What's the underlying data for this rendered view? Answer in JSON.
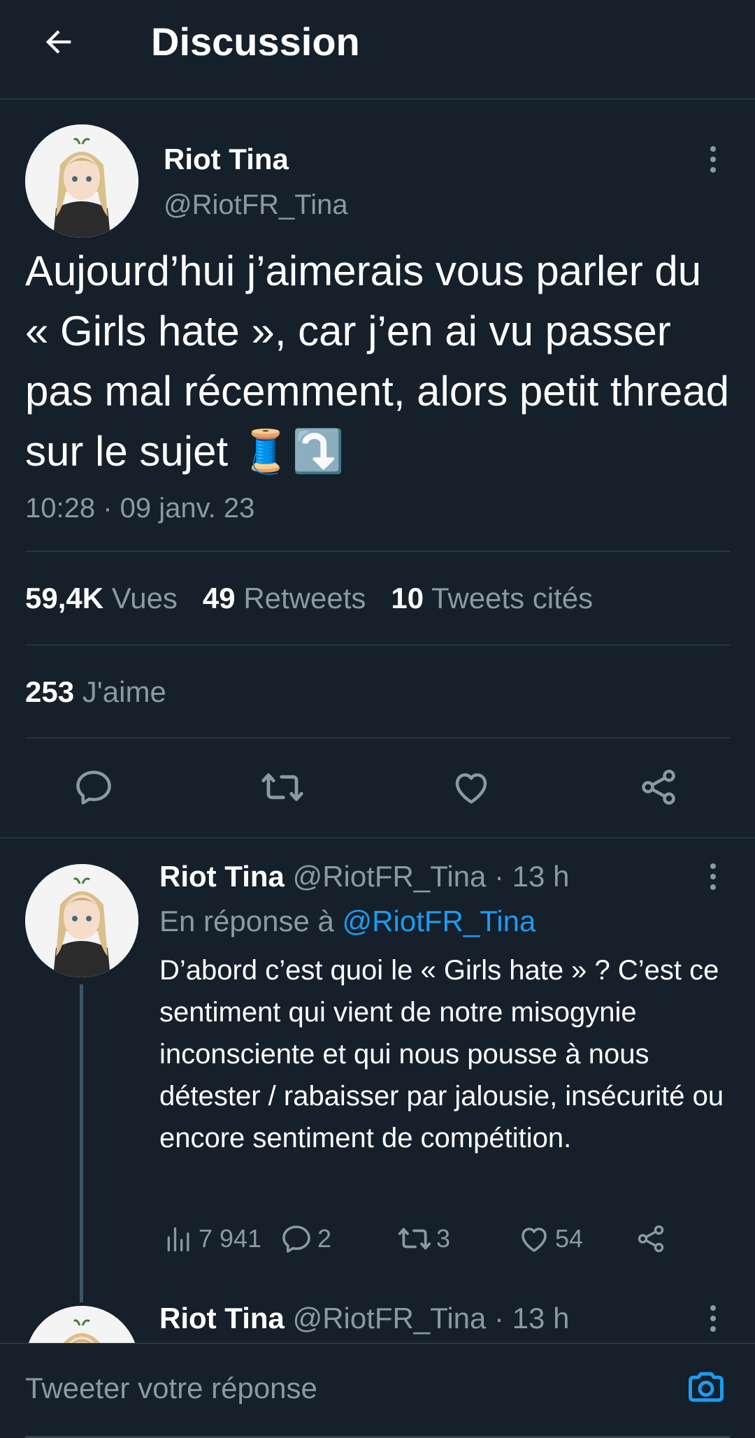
{
  "header": {
    "title": "Discussion",
    "back_icon": "arrow-left-icon"
  },
  "tweet": {
    "author_name": "Riot Tina",
    "author_handle": "@RiotFR_Tina",
    "text": "Aujourd’hui j’aimerais vous parler du « Girls hate », car j’en ai vu passer pas mal récemment, alors petit thread sur le sujet 🧵⤵️",
    "timestamp": "10:28 · 09 janv. 23",
    "views_count": "59,4K",
    "views_label": "Vues",
    "retweets_count": "49",
    "retweets_label": "Retweets",
    "quotes_count": "10",
    "quotes_label": "Tweets cités",
    "likes_count": "253",
    "likes_label": "J'aime"
  },
  "reply": {
    "author_name": "Riot Tina",
    "meta": "@RiotFR_Tina · 13 h",
    "in_reply_prefix": "En réponse à",
    "in_reply_handle": "@RiotFR_Tina",
    "text": "D’abord c’est quoi le « Girls hate » ? C’est ce sentiment qui vient de notre misogynie inconsciente et qui nous pousse à nous détester / rabaisser  par jalousie, insécurité ou encore sentiment de compétition.",
    "views": "7 941",
    "replies": "2",
    "retweets": "3",
    "likes": "54"
  },
  "next_reply": {
    "author_name": "Riot Tina",
    "meta": "@RiotFR_Tina · 13 h"
  },
  "composer": {
    "placeholder": "Tweeter votre réponse",
    "camera_icon": "camera-icon"
  },
  "colors": {
    "background": "#15202b",
    "text": "#ffffff",
    "secondary": "#8b98a5",
    "accent": "#1d9bf0",
    "divider": "#38444d"
  }
}
